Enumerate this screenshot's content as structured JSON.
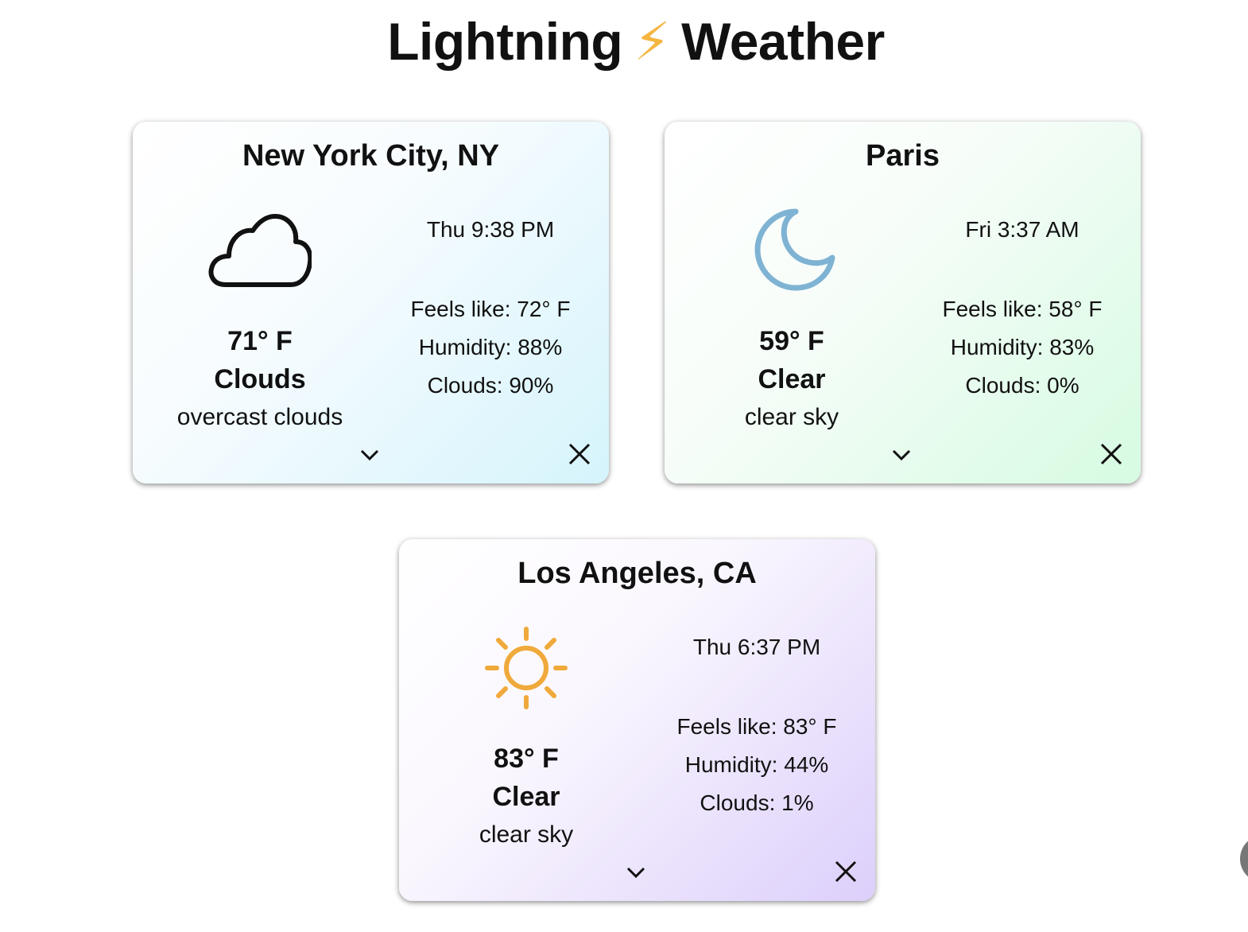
{
  "app": {
    "title_left": "Lightning",
    "title_bolt": "⚡",
    "title_right": "Weather"
  },
  "cards": [
    {
      "city": "New York City, NY",
      "icon": "cloud-icon",
      "temp": "71° F",
      "condition": "Clouds",
      "description": "overcast clouds",
      "time": "Thu 9:38 PM",
      "feels_like": "Feels like: 72° F",
      "humidity": "Humidity: 88%",
      "clouds": "Clouds: 90%",
      "accent": "#d5f4fc"
    },
    {
      "city": "Paris",
      "icon": "moon-icon",
      "temp": "59° F",
      "condition": "Clear",
      "description": "clear sky",
      "time": "Fri 3:37 AM",
      "feels_like": "Feels like: 58° F",
      "humidity": "Humidity: 83%",
      "clouds": "Clouds: 0%",
      "accent": "#d6fbe2"
    },
    {
      "city": "Los Angeles, CA",
      "icon": "sun-icon",
      "temp": "83° F",
      "condition": "Clear",
      "description": "clear sky",
      "time": "Thu 6:37 PM",
      "feels_like": "Feels like: 83° F",
      "humidity": "Humidity: 44%",
      "clouds": "Clouds: 1%",
      "accent": "#dccffb"
    }
  ],
  "colors": {
    "bolt": "#f5b642",
    "moon": "#7fb3d3",
    "sun": "#f0a93b"
  }
}
